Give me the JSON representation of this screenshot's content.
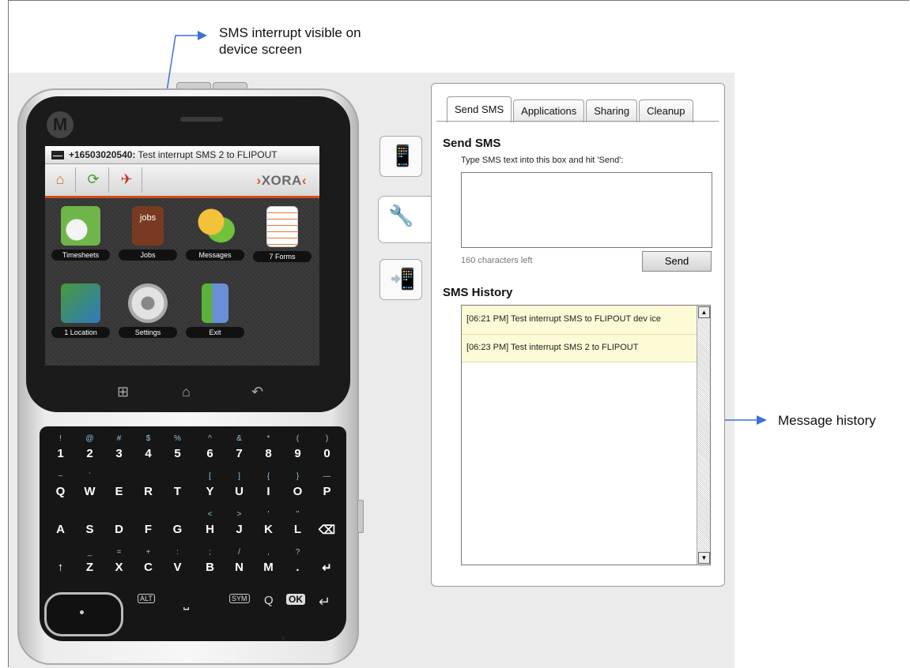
{
  "callouts": {
    "top": "SMS interrupt visible on device screen",
    "top_line1": "SMS interrupt visible on",
    "top_line2": "device screen",
    "right": "Message history"
  },
  "device": {
    "notification_sender": "+16503020540:",
    "notification_text": " Test interrupt SMS 2 to FLIPOUT",
    "brand": "XORA",
    "apps": [
      {
        "label": "Timesheets",
        "icon": "timesheet-icon"
      },
      {
        "label": "Jobs",
        "icon": "jobs-icon"
      },
      {
        "label": "Messages",
        "icon": "messages-icon"
      },
      {
        "label": "7 Forms",
        "icon": "forms-icon"
      },
      {
        "label": "1 Location",
        "icon": "location-icon"
      },
      {
        "label": "Settings",
        "icon": "settings-icon"
      },
      {
        "label": "Exit",
        "icon": "exit-icon"
      }
    ],
    "apps_label_jobs_overlay": "jobs",
    "keyboard_rows": [
      [
        [
          "!",
          "1"
        ],
        [
          "@",
          "2"
        ],
        [
          "#",
          "3"
        ],
        [
          "$",
          "4"
        ],
        [
          "%",
          "5"
        ],
        [
          "^",
          "6"
        ],
        [
          "&",
          "7"
        ],
        [
          "*",
          "8"
        ],
        [
          "(",
          "9"
        ],
        [
          ")",
          "0"
        ]
      ],
      [
        [
          "~",
          "Q"
        ],
        [
          "`",
          "W"
        ],
        [
          "",
          "E"
        ],
        [
          "",
          "R"
        ],
        [
          "",
          "T"
        ],
        [
          "[",
          "Y"
        ],
        [
          "]",
          "U"
        ],
        [
          "{",
          "I"
        ],
        [
          "}",
          "O"
        ],
        [
          "—",
          "P"
        ]
      ],
      [
        [
          "",
          "A"
        ],
        [
          "",
          "S"
        ],
        [
          "",
          "D"
        ],
        [
          "",
          "F"
        ],
        [
          "",
          "G"
        ],
        [
          "<",
          "H"
        ],
        [
          ">",
          "J"
        ],
        [
          "'",
          "K"
        ],
        [
          "\"",
          "L"
        ],
        [
          "",
          "⌫"
        ]
      ],
      [
        [
          "",
          "↑"
        ],
        [
          "_",
          "Z"
        ],
        [
          "=",
          "X"
        ],
        [
          "+",
          "C"
        ],
        [
          ":",
          "V"
        ],
        [
          ";",
          "B"
        ],
        [
          "/",
          "N"
        ],
        [
          ",",
          "M"
        ],
        [
          "?",
          "."
        ],
        [
          "",
          "↵"
        ]
      ]
    ],
    "bottom_keys": {
      "alt": "ALT",
      "space": "⎵",
      "sym": "SYM",
      "search": "Q",
      "ok": "OK",
      "enter": "↵"
    }
  },
  "panel": {
    "tabs": [
      "Send SMS",
      "Applications",
      "Sharing",
      "Cleanup"
    ],
    "active_tab": "Send SMS",
    "send_sms_heading": "Send SMS",
    "send_sms_hint": "Type SMS text into this box and hit 'Send':",
    "sms_input_value": "",
    "chars_left": "160 characters left",
    "send_button": "Send",
    "history_heading": "SMS History",
    "history": [
      "[06:21 PM] Test interrupt SMS to FLIPOUT dev ice",
      "[06:23 PM] Test interrupt SMS 2 to FLIPOUT"
    ]
  },
  "colors": {
    "accent_orange": "#e05a14",
    "callout_arrow": "#3f6fd8",
    "history_bg": "#fdfbd6"
  }
}
